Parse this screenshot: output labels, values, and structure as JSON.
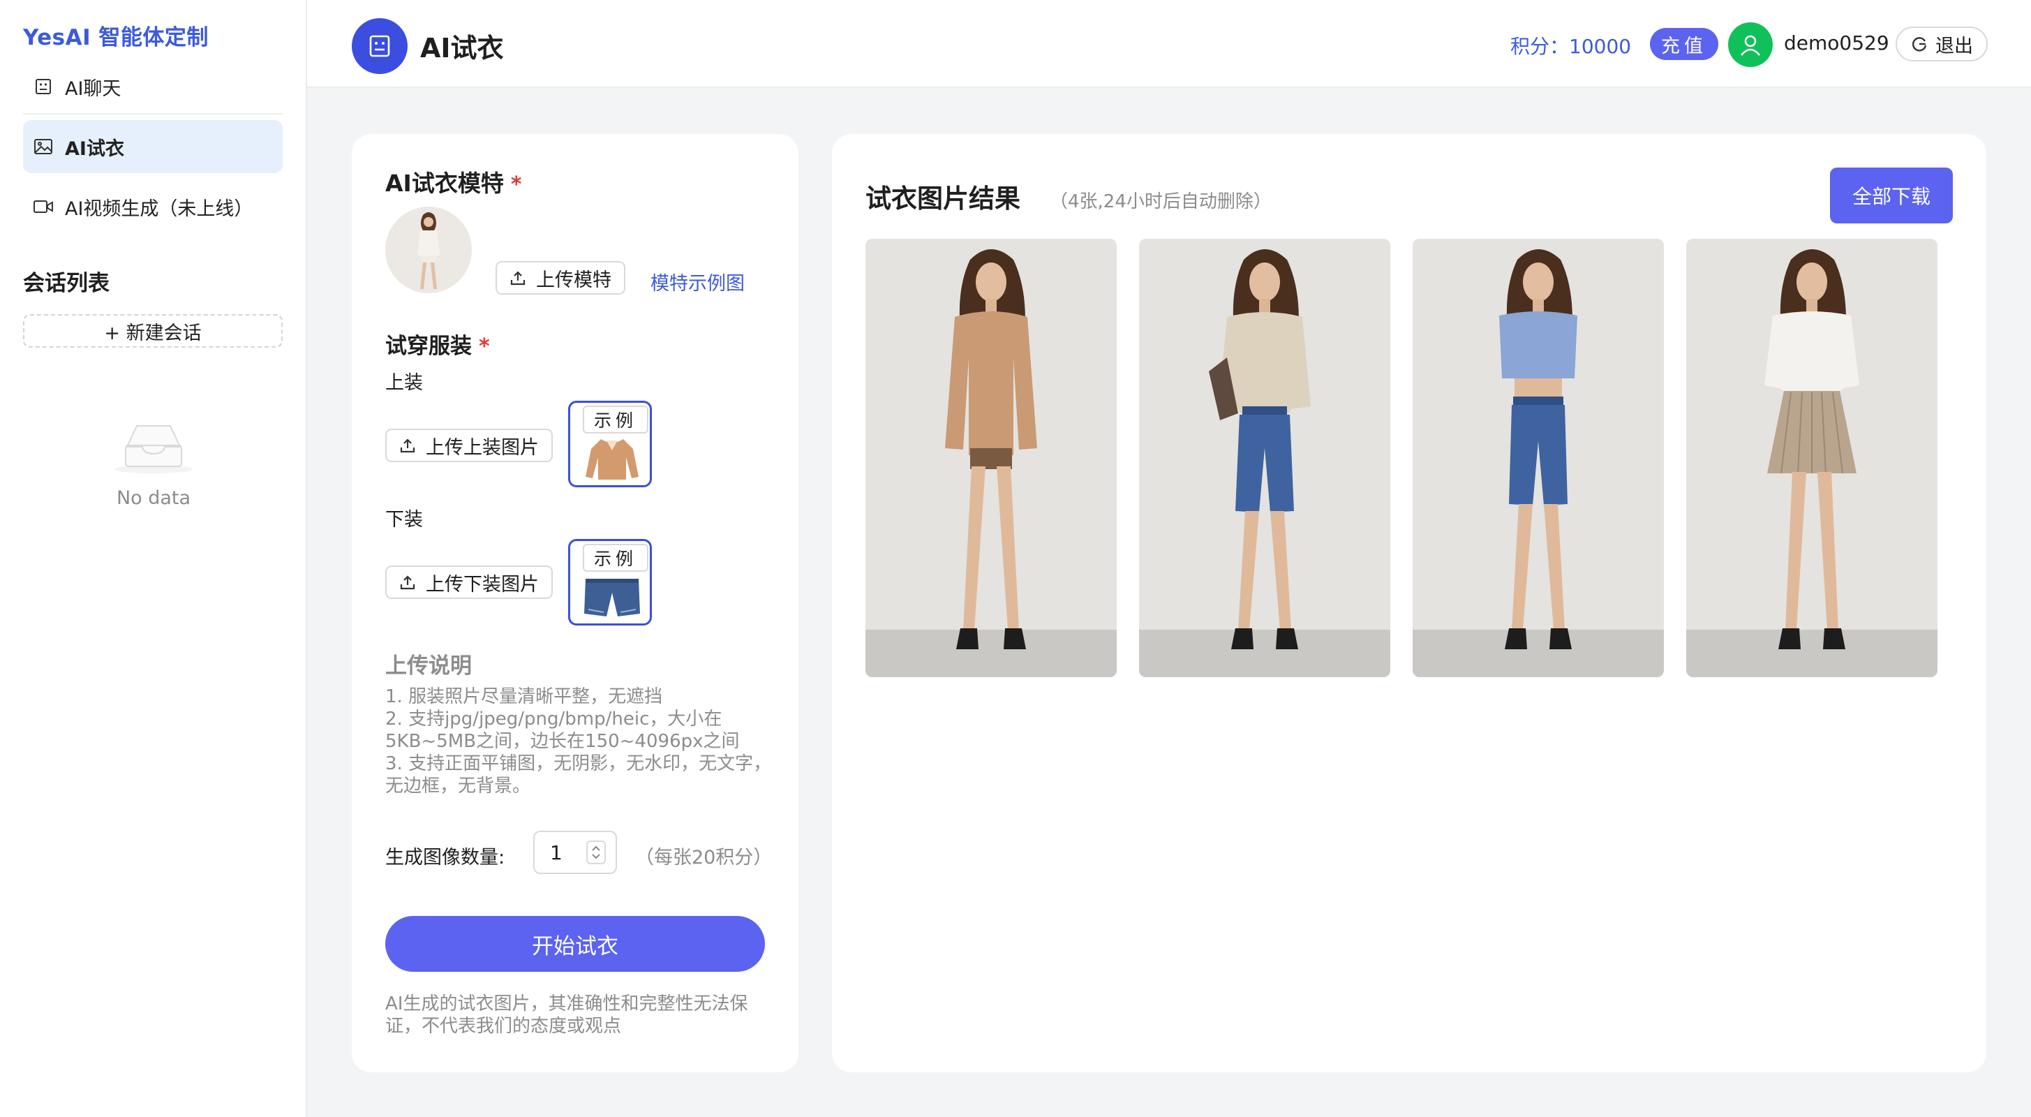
{
  "sidebar": {
    "brand": "YesAI 智能体定制",
    "items": [
      {
        "label": "AI聊天",
        "icon": "robot-icon"
      },
      {
        "label": "AI试衣",
        "icon": "image-icon"
      },
      {
        "label": "AI视频生成（未上线）",
        "icon": "video-icon"
      }
    ],
    "section_title": "会话列表",
    "new_chat": "+ 新建会话",
    "empty_text": "No data"
  },
  "header": {
    "title": "AI试衣",
    "points": "积分：10000",
    "recharge": "充值",
    "username": "demo0529",
    "logout": "退出"
  },
  "left_card": {
    "model_title": "AI试衣模特",
    "upload_model": "上传模特",
    "model_example_link": "模特示例图",
    "clothes_title": "试穿服装",
    "top_label": "上装",
    "upload_top": "上传上装图片",
    "sample_tag": "示例",
    "bottom_label": "下装",
    "upload_bottom": "上传下装图片",
    "notes_title": "上传说明",
    "notes": [
      "1. 服装照片尽量清晰平整，无遮挡",
      "2. 支持jpg/jpeg/png/bmp/heic，大小在5KB~5MB之间，边长在150~4096px之间",
      "3. 支持正面平铺图，无阴影，无水印，无文字，无边框，无背景。"
    ],
    "qty_label": "生成图像数量:",
    "qty_value": "1",
    "qty_note": "（每张20积分）",
    "start_button": "开始试衣",
    "disclaimer": "AI生成的试衣图片，其准确性和完整性无法保证，不代表我们的态度或观点"
  },
  "right_card": {
    "title": "试衣图片结果",
    "subtitle": "（4张,24小时后自动删除）",
    "download_all": "全部下载"
  },
  "colors": {
    "brand": "#3b5bdb",
    "primary_button": "#5b63f0",
    "avatar_green": "#10c15a",
    "required": "#e53935"
  }
}
